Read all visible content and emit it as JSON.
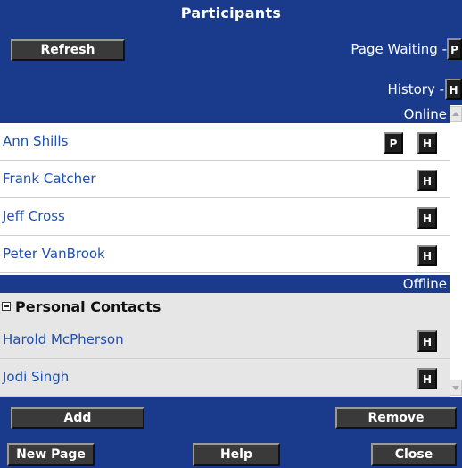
{
  "window": {
    "title": "Participants"
  },
  "toolbar": {
    "refresh_label": "Refresh",
    "page_waiting_label": "Page Waiting -",
    "page_waiting_btn": "P",
    "history_label": "History -",
    "history_btn": "H"
  },
  "online": {
    "header": "Online",
    "rows": [
      {
        "name": "Ann Shills",
        "page_btn": "P",
        "history_btn": "H"
      },
      {
        "name": "Frank Catcher",
        "history_btn": "H"
      },
      {
        "name": "Jeff Cross",
        "history_btn": "H"
      },
      {
        "name": "Peter VanBrook",
        "history_btn": "H"
      }
    ]
  },
  "offline": {
    "header": "Offline",
    "group_label": "Personal Contacts",
    "rows": [
      {
        "name": "Harold McPherson",
        "history_btn": "H"
      },
      {
        "name": "Jodi Singh",
        "history_btn": "H"
      }
    ]
  },
  "actions": {
    "add_label": "Add",
    "remove_label": "Remove",
    "new_page_label": "New Page",
    "help_label": "Help",
    "close_label": "Close"
  },
  "colors": {
    "panel_blue": "#1a3a8c",
    "button_dark": "#3a3a3a",
    "name_link": "#1d50b0",
    "offline_row_bg": "#e6e6e6"
  }
}
